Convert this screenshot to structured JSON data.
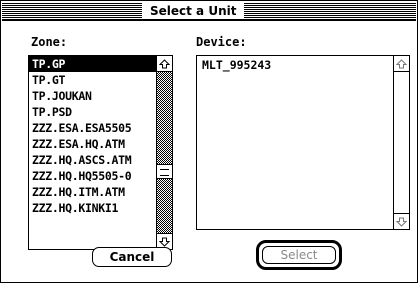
{
  "dialog": {
    "title": "Select a Unit",
    "zone_label": "Zone:",
    "device_label": "Device:"
  },
  "zones": {
    "items": [
      "TP.GP",
      "TP.GT",
      "TP.JOUKAN",
      "TP.PSD",
      "ZZZ.ESA.ESA5505",
      "ZZZ.ESA.HQ.ATM",
      "ZZZ.HQ.ASCS.ATM",
      "ZZZ.HQ.HQ5505-0",
      "ZZZ.HQ.ITM.ATM",
      "ZZZ.HQ.KINKI1"
    ],
    "selected": "TP.GP"
  },
  "devices": {
    "items": [
      "MLT_995243"
    ]
  },
  "buttons": {
    "cancel": "Cancel",
    "select": "Select"
  },
  "icons": {
    "scroll_up": "up-arrow-icon",
    "scroll_down": "down-arrow-icon"
  }
}
